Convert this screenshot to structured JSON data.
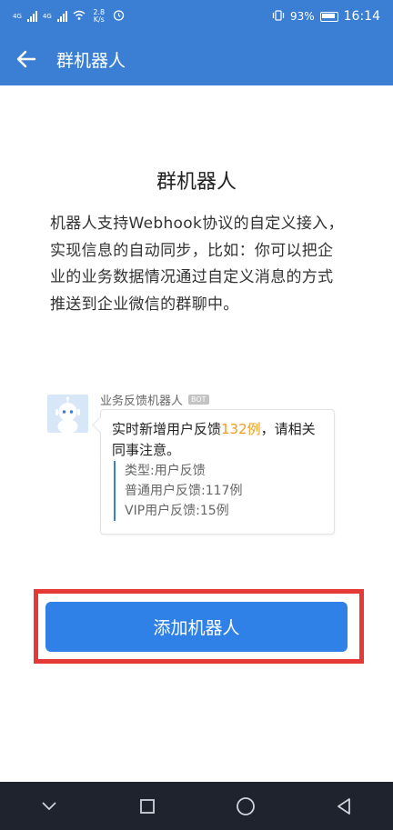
{
  "status_bar": {
    "sig1_label": "4G",
    "sig2_label": "4G",
    "net_speed": "2.8 K/s",
    "battery": "93%",
    "time": "16:14"
  },
  "app_bar": {
    "title": "群机器人"
  },
  "main": {
    "headline": "群机器人",
    "description": "机器人支持Webhook协议的自定义接入，实现信息的自动同步，比如：你可以把企业的业务数据情况通过自定义消息的方式推送到企业微信的群聊中。"
  },
  "demo_message": {
    "bot_name": "业务反馈机器人",
    "bot_badge": "BOT",
    "text_before": "实时新增用户反馈",
    "text_highlight": "132例",
    "text_after": "，请相关同事注意。",
    "quote_lines": [
      "类型:用户反馈",
      "普通用户反馈:117例",
      "VIP用户反馈:15例"
    ]
  },
  "actions": {
    "add_button_label": "添加机器人"
  },
  "colors": {
    "brand_blue": "#3a7fd3",
    "button_blue": "#2f81e8",
    "highlight_orange": "#f29c1f",
    "annotation_red": "#e53935"
  },
  "nav_icons": [
    "chevron-down-icon",
    "square-recent-icon",
    "circle-home-icon",
    "triangle-back-icon"
  ]
}
